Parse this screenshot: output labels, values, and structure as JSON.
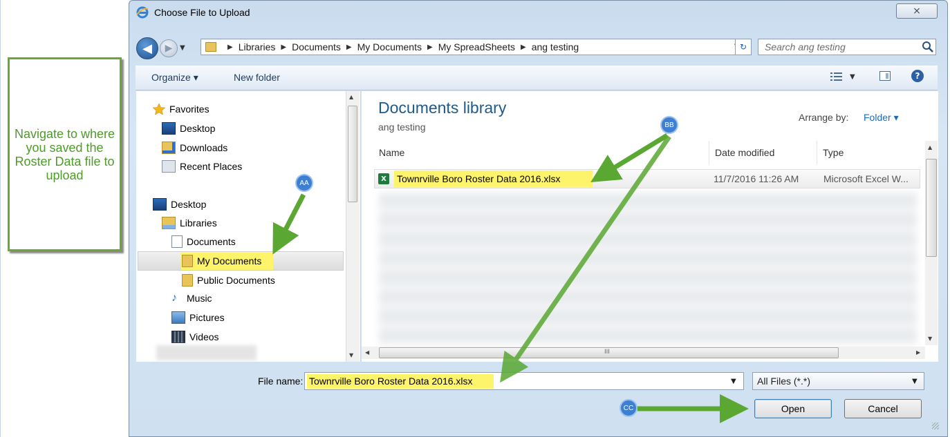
{
  "callout": {
    "text": "Navigate to where you saved the Roster Data file to upload"
  },
  "window": {
    "title": "Choose File to Upload",
    "close_label": "⨯"
  },
  "address": {
    "crumbs": [
      "Libraries",
      "Documents",
      "My Documents",
      "My SpreadSheets",
      "ang testing"
    ]
  },
  "search": {
    "placeholder": "Search ang testing"
  },
  "toolbar": {
    "organize_label": "Organize ▾",
    "new_folder_label": "New folder"
  },
  "nav": {
    "favorites": "Favorites",
    "fav_desktop": "Desktop",
    "fav_downloads": "Downloads",
    "fav_recent": "Recent Places",
    "desktop": "Desktop",
    "libraries": "Libraries",
    "documents": "Documents",
    "my_documents": "My Documents",
    "public_documents": "Public Documents",
    "music": "Music",
    "pictures": "Pictures",
    "videos": "Videos"
  },
  "content": {
    "library_title": "Documents library",
    "library_subtitle": "ang testing",
    "arrange_label": "Arrange by:",
    "arrange_value": "Folder ▾",
    "columns": {
      "name": "Name",
      "date": "Date modified",
      "type": "Type"
    },
    "file": {
      "icon": "X",
      "name": "Townrville Boro Roster Data 2016.xlsx",
      "date": "11/7/2016 11:26 AM",
      "type": "Microsoft Excel W..."
    }
  },
  "footer": {
    "file_name_label": "File name:",
    "file_name_value": "Townrville Boro Roster Data 2016.xlsx",
    "filter_value": "All Files (*.*)",
    "open_label": "Open",
    "cancel_label": "Cancel"
  },
  "annotations": {
    "aa": "AA",
    "bb": "BB",
    "cc": "CC"
  },
  "colors": {
    "highlight": "#fdf46b",
    "arrow": "#5aa832",
    "badge": "#3f7fd1",
    "callout_border": "#6aa832"
  }
}
